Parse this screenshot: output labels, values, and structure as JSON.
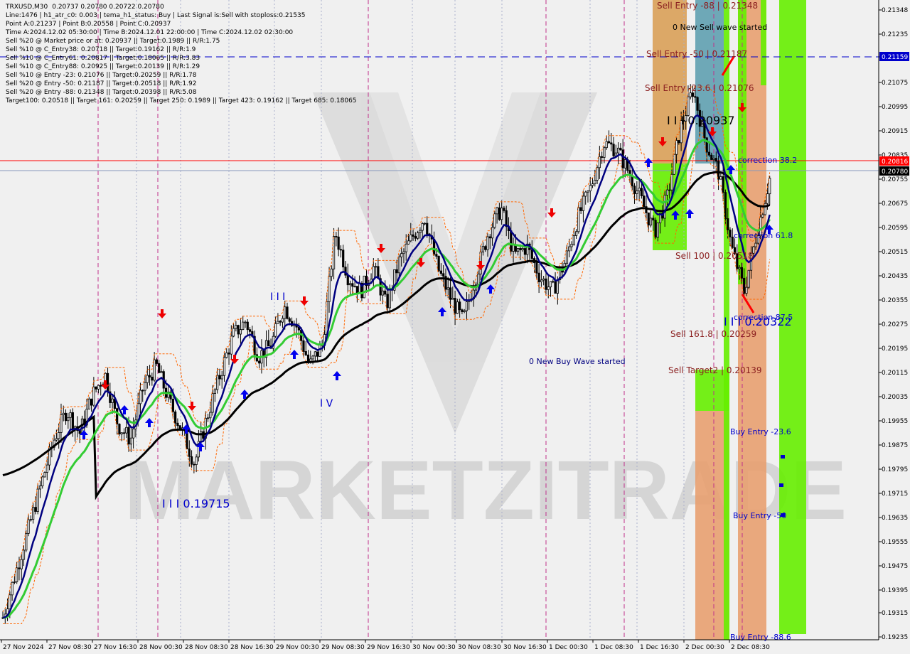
{
  "header": {
    "symbol": "TRXUSD,M30",
    "ohlc": "0.20737 0.20780 0.20722 0.20780",
    "info_lines": [
      "Line:1476 | h1_atr_c0: 0.003 | tema_h1_status: Buy | Last Signal is:Sell with stoploss:0.21535",
      "Point A:0.21237 | Point B:0.20558 | Point C:0.20937",
      "Time A:2024.12.02 05:30:00 | Time B:2024.12.01 22:00:00 | Time C:2024.12.02 02:30:00",
      "Sell %20 @ Market price or at: 0.20937 || Target:0.1989 || R/R:1.75",
      "Sell %10 @ C_Entry38: 0.20718 || Target:0.19162 || R/R:1.9",
      "Sell %10 @ C_Entry61: 0.20817 || Target:0.18065 || R/R:3.83",
      "Sell %10 @ C_Entry88: 0.20925 || Target:0.20139 || R/R:1.29",
      "Sell %10 @ Entry -23: 0.21076 || Target:0.20259 || R/R:1.78",
      "Sell %20 @ Entry -50: 0.21187 || Target:0.20518 || R/R:1.92",
      "Sell %20 @ Entry -88: 0.21348 || Target:0.20398 || R/R:5.08",
      "Target100: 0.20518 || Target 161: 0.20259 || Target 250: 0.1989 || Target 423: 0.19162 || Target 685: 0.18065"
    ]
  },
  "watermark": "MARKETZITRADE",
  "price_tags": {
    "blue": "0.21159",
    "red": "0.20816",
    "current": "0.20780"
  },
  "annotations": {
    "sell_entry_88": "Sell Entry -88 | 0.21348",
    "new_sell_wave": "0 New Sell wave started",
    "sell_entry_50": "Sell Entry -50 | 0.21187",
    "sell_entry_23": "Sell Entry -23.6 | 0.21076",
    "level_c": "I I I 0.20937",
    "correction_38": "correction 38.2",
    "correction_61": "correction 61.8",
    "sell_100": "Sell 100 | 0.20518",
    "correction_87": "correction 87.5",
    "level_iii_b": "I I I 0.20322",
    "sell_161": "Sell 161.8 | 0.20259",
    "sell_target2": "Sell Target2 | 0.20139",
    "new_buy_wave": "0 New Buy Wave started",
    "buy_entry_23": "Buy Entry -23.6",
    "buy_entry_50": "Buy Entry -50",
    "buy_entry_88": "Buy Entry -88.6",
    "level_low": "I I I 0.19715",
    "wave_iv": "I V",
    "wave_iii": "I I I"
  },
  "colors": {
    "background": "#f0f0f0",
    "bull_candle": "#000000",
    "tema_blue": "#000080",
    "ema_green": "#33cc33",
    "ma_black": "#000000",
    "band_orange": "#ff6600",
    "zone_green": "#66ee00",
    "zone_orange": "#e8a070",
    "zone_teal": "#5fa0b0",
    "blue_line": "#0000cc",
    "red_line": "#ff0000"
  },
  "chart_data": {
    "type": "candlestick",
    "symbol": "TRXUSD",
    "timeframe": "M30",
    "ylim": [
      0.19235,
      0.21348
    ],
    "y_ticks": [
      "0.21348",
      "0.21235",
      "0.21159",
      "0.21075",
      "0.20995",
      "0.20915",
      "0.20835",
      "0.20755",
      "0.20675",
      "0.20595",
      "0.20515",
      "0.20435",
      "0.20355",
      "0.20275",
      "0.20195",
      "0.20115",
      "0.20035",
      "0.19955",
      "0.19875",
      "0.19795",
      "0.19715",
      "0.19635",
      "0.19555",
      "0.19475",
      "0.19395",
      "0.19315",
      "0.19235"
    ],
    "x_ticks": [
      "27 Nov 2024",
      "27 Nov 08:30",
      "27 Nov 16:30",
      "28 Nov 00:30",
      "28 Nov 08:30",
      "28 Nov 16:30",
      "29 Nov 00:30",
      "29 Nov 08:30",
      "29 Nov 16:30",
      "30 Nov 00:30",
      "30 Nov 08:30",
      "30 Nov 16:30",
      "1 Dec 00:30",
      "1 Dec 08:30",
      "1 Dec 16:30",
      "2 Dec 00:30",
      "2 Dec 08:30"
    ],
    "close_path": [
      0.193,
      0.1945,
      0.196,
      0.1975,
      0.199,
      0.2,
      0.1992,
      0.2005,
      0.2012,
      0.1995,
      0.199,
      0.2008,
      0.2015,
      0.2003,
      0.1993,
      0.1982,
      0.1998,
      0.2012,
      0.2025,
      0.203,
      0.2018,
      0.2022,
      0.2035,
      0.2028,
      0.2015,
      0.2022,
      0.206,
      0.2045,
      0.204,
      0.2048,
      0.2035,
      0.205,
      0.2058,
      0.2065,
      0.2048,
      0.2038,
      0.203,
      0.2045,
      0.206,
      0.2068,
      0.2052,
      0.2055,
      0.2045,
      0.204,
      0.205,
      0.2065,
      0.2075,
      0.209,
      0.2088,
      0.208,
      0.207,
      0.206,
      0.2072,
      0.2095,
      0.2108,
      0.209,
      0.208,
      0.2055,
      0.204,
      0.206,
      0.2078
    ],
    "levels": {
      "blue_dashed": 0.21159,
      "red_solid": 0.20816,
      "current": 0.2078
    }
  }
}
